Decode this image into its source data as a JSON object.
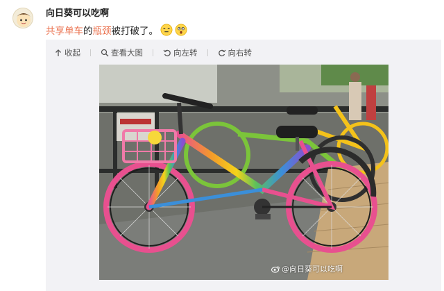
{
  "post": {
    "username": "向日葵可以吃啊",
    "text_link": "共享单车",
    "text_mid": "的",
    "text_link2": "瓶颈",
    "text_rest": "被打破了。",
    "emoji_1": "dizzy-face-emoji",
    "emoji_2": "surprised-face-emoji"
  },
  "toolbar": {
    "collapse_label": "收起",
    "view_large_label": "查看大图",
    "rotate_left_label": "向左转",
    "rotate_right_label": "向右转"
  },
  "image": {
    "watermark": "@向日葵可以吃啊"
  },
  "colors": {
    "link": "#eb7350",
    "media_bg": "#f2f2f5",
    "bike_pink": "#e8508f",
    "bike_rainbow_blue": "#3b8fd9",
    "bike_green": "#7bc43a",
    "bike_yellow": "#f4c21a"
  }
}
